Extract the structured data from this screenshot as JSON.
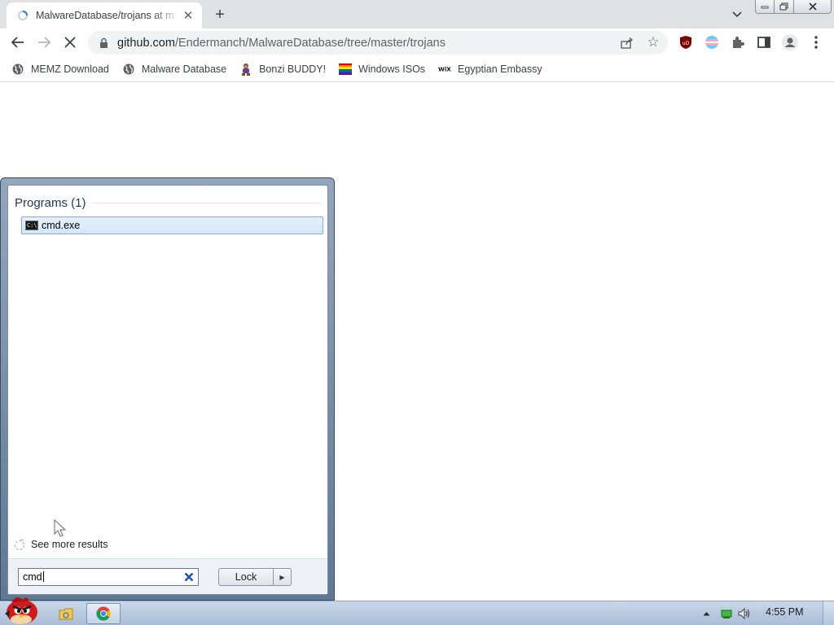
{
  "browser": {
    "tab": {
      "title": "MalwareDatabase/trojans at m",
      "favicon": "loading-spinner-icon"
    },
    "url": {
      "host": "github.com",
      "path": "/Endermanch/MalwareDatabase/tree/master/trojans"
    },
    "bookmarks": [
      {
        "label": "MEMZ Download",
        "icon": "globe-icon"
      },
      {
        "label": "Malware Database",
        "icon": "globe-icon"
      },
      {
        "label": "Bonzi BUDDY!",
        "icon": "bonzi-icon"
      },
      {
        "label": "Windows ISOs",
        "icon": "rainbow-flag-icon"
      },
      {
        "label": "Egyptian Embassy",
        "icon": "wix-icon"
      }
    ],
    "wix_icon_text": "WiX",
    "ublock_text": "uD"
  },
  "start_menu": {
    "programs_heading": "Programs (1)",
    "results": [
      {
        "label": "cmd.exe",
        "icon": "cmd-icon",
        "icon_text": "C:\\"
      }
    ],
    "see_more": "See more results",
    "search_value": "cmd",
    "lock_label": "Lock"
  },
  "taskbar": {
    "clock": "4:55 PM",
    "items": [
      "explorer-icon",
      "chrome-icon"
    ]
  },
  "colors": {
    "tabstrip": "#dfe1e5",
    "omnibox": "#f1f3f4",
    "startmenu_frame": "#93a6bd",
    "selection": "#d4e6fa",
    "taskbar": "#b9cbe0"
  }
}
